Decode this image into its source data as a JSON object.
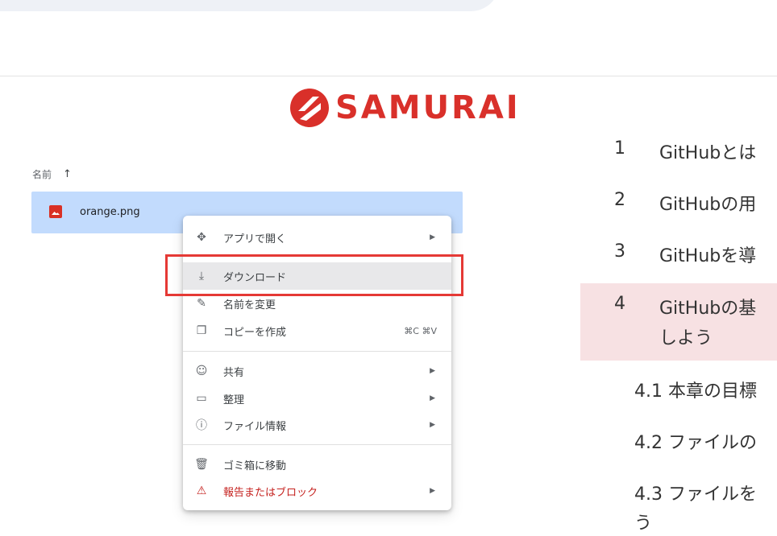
{
  "logo": {
    "text": "SAMURAI",
    "brand_color": "#d9302a"
  },
  "file_list": {
    "column_header": "名前",
    "sort_icon": "arrow-up-icon",
    "selected_row_color": "#c2dbfd",
    "files": [
      {
        "name": "orange.png",
        "icon": "image-file-icon"
      }
    ]
  },
  "context_menu": {
    "items": [
      {
        "label": "アプリで開く",
        "icon": "move-arrows-icon",
        "has_submenu": true
      },
      {
        "label": "ダウンロード",
        "icon": "download-icon",
        "highlighted": true
      },
      {
        "label": "名前を変更",
        "icon": "pencil-icon"
      },
      {
        "label": "コピーを作成",
        "icon": "copy-icon",
        "shortcut": "⌘C ⌘V"
      },
      {
        "label": "共有",
        "icon": "person-add-icon",
        "has_submenu": true
      },
      {
        "label": "整理",
        "icon": "folder-icon",
        "has_submenu": true
      },
      {
        "label": "ファイル情報",
        "icon": "info-icon",
        "has_submenu": true
      },
      {
        "label": "ゴミ箱に移動",
        "icon": "trash-icon"
      },
      {
        "label": "報告またはブロック",
        "icon": "report-icon",
        "has_submenu": true,
        "danger": true
      }
    ],
    "highlight_box_color": "#e53935"
  },
  "toc": {
    "active_color": "#f7e1e3",
    "items": [
      {
        "num": "1",
        "title": "GitHubとは"
      },
      {
        "num": "2",
        "title": "GitHubの用"
      },
      {
        "num": "3",
        "title": "GitHubを導"
      },
      {
        "num": "4",
        "title": "GitHubの基",
        "title_line2": "しよう",
        "active": true
      }
    ],
    "subitems": [
      {
        "text": "4.1 本章の目標"
      },
      {
        "text": "4.2 ファイルの"
      },
      {
        "text": "4.3 ファイルを",
        "line2": "う"
      }
    ]
  }
}
